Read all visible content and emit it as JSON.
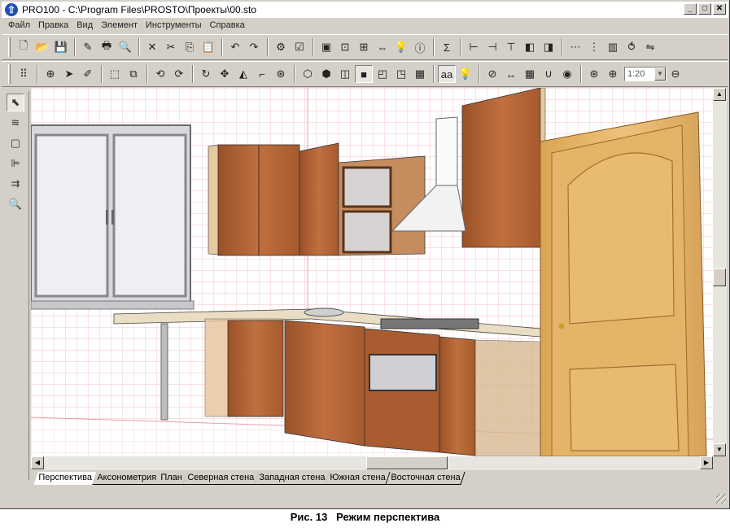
{
  "window": {
    "title": "PRO100 - C:\\Program Files\\PROSTO\\Проекты\\00.sto",
    "minimize": "_",
    "maximize": "□",
    "close": "✕"
  },
  "menu": {
    "items": [
      "Файл",
      "Правка",
      "Вид",
      "Элемент",
      "Инструменты",
      "Справка"
    ]
  },
  "toolbar1": {
    "icons": [
      "new-file-icon",
      "open-folder-icon",
      "save-icon",
      "edit-doc-icon",
      "print-icon",
      "print-preview-icon",
      "cut-x-icon",
      "scissors-icon",
      "copy-icon",
      "paste-icon",
      "undo-icon",
      "redo-icon",
      "properties-icon",
      "checklist-icon",
      "view-window-icon",
      "zoom-window-icon",
      "select-window-icon",
      "fit-width-icon",
      "light-window-icon",
      "info-window-icon",
      "sum-icon",
      "align-left-icon",
      "align-right-icon",
      "align-top-icon",
      "stack-front-icon",
      "stack-back-icon",
      "distribute-h-icon",
      "distribute-v-icon",
      "equal-height-icon",
      "rotate-group-icon",
      "flip-group-icon"
    ],
    "glyphs": [
      "🗋",
      "📂",
      "💾",
      "✎",
      "🖶",
      "🔍",
      "✕",
      "✂",
      "⎘",
      "📋",
      "↶",
      "↷",
      "⚙",
      "☑",
      "▣",
      "⊡",
      "⊞",
      "⇔",
      "💡",
      "ⓘ",
      "Σ",
      "⊢",
      "⊣",
      "⊤",
      "◧",
      "◨",
      "⋯",
      "⋮",
      "▥",
      "⥀",
      "⇋"
    ]
  },
  "toolbar2": {
    "icons": [
      "grid-select-icon",
      "insert-icon",
      "move-cursor-icon",
      "pencil-icon",
      "box-select-icon",
      "group-select-icon",
      "rotate-left-icon",
      "rotate-right-icon",
      "refresh-icon",
      "move-arrows-icon",
      "mirror-icon",
      "corner-icon",
      "target-icon",
      "cube-wire-icon",
      "cube-solid-icon",
      "cube-side-icon",
      "cube-shaded-icon",
      "cube-front-icon",
      "cube-back-icon",
      "cube-color-icon",
      "text-aa-icon",
      "lightbulb-icon",
      "measure-icon",
      "dimension-icon",
      "grid-toggle-icon",
      "magnet-icon",
      "snap-icon",
      "target2-icon",
      "zoom-in-icon",
      "zoom-out-icon"
    ],
    "glyphs": [
      "⠿",
      "⊕",
      "➤",
      "✐",
      "⬚",
      "⧉",
      "⟲",
      "⟳",
      "↻",
      "✥",
      "◭",
      "⌐",
      "⊛",
      "⬡",
      "⬢",
      "◫",
      "■",
      "◰",
      "◳",
      "▦",
      "aa",
      "💡",
      "⊘",
      "↔",
      "▦",
      "∪",
      "◉",
      "⊛",
      "⊕",
      "⊖"
    ],
    "pressed": [
      16,
      20
    ],
    "zoom_value": "1:20"
  },
  "left_toolbar": {
    "icons": [
      "pointer-icon",
      "snap-elements-icon",
      "bounding-box-icon",
      "align-tool-icon",
      "distribute-tool-icon",
      "zoom-tool-icon"
    ],
    "glyphs": [
      "⬉",
      "≋",
      "▢",
      "⊫",
      "⇉",
      "🔍"
    ]
  },
  "tabs": [
    "Перспектива",
    "Аксонометрия",
    "План",
    "Северная стена",
    "Западная стена",
    "Южная стена",
    "Восточная стена"
  ],
  "active_tab": 0,
  "scrollbars": {
    "vertical_position": 0.5,
    "horizontal_position": 0.5
  },
  "caption": {
    "label": "Рис. 13",
    "text": "Режим перспектива"
  },
  "colors": {
    "face": "#d4d0c8",
    "grid": "#f4b0b8",
    "wood": "#b8683a",
    "door": "#e0b46a"
  }
}
